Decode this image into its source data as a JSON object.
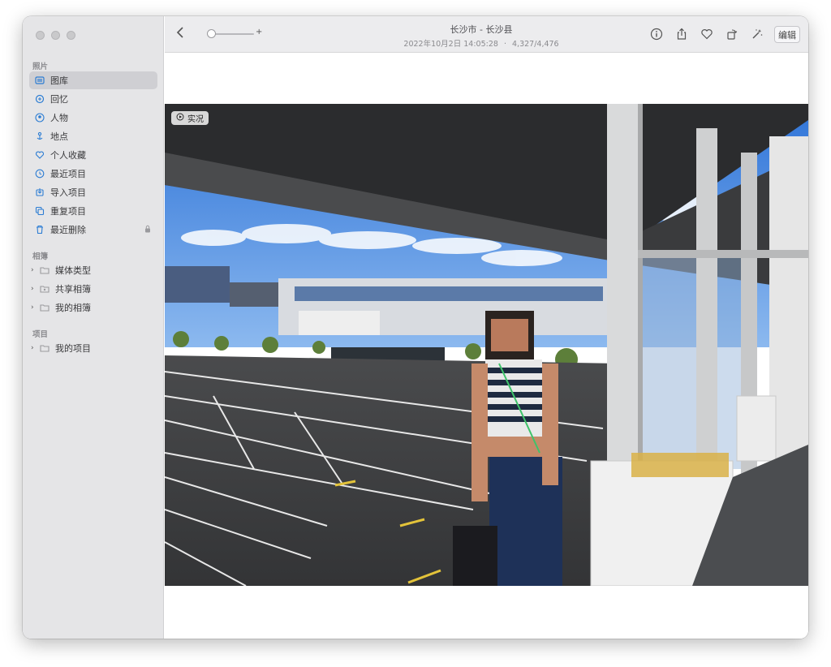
{
  "window": {
    "title": "长沙市 - 长沙县",
    "subtitle_date": "2022年10月2日 14:05:28",
    "subtitle_sep": "·",
    "subtitle_count": "4,327/4,476"
  },
  "toolbar": {
    "zoom_plus": "+",
    "edit_label": "编辑"
  },
  "sidebar": {
    "sections": [
      {
        "title": "照片",
        "items": [
          {
            "label": "图库",
            "icon": "library-icon",
            "selected": true
          },
          {
            "label": "回忆",
            "icon": "memories-icon"
          },
          {
            "label": "人物",
            "icon": "people-icon"
          },
          {
            "label": "地点",
            "icon": "places-icon"
          },
          {
            "label": "个人收藏",
            "icon": "heart-icon"
          },
          {
            "label": "最近项目",
            "icon": "clock-icon"
          },
          {
            "label": "导入项目",
            "icon": "import-icon"
          },
          {
            "label": "重复项目",
            "icon": "duplicates-icon"
          },
          {
            "label": "最近删除",
            "icon": "trash-icon",
            "locked": true
          }
        ]
      },
      {
        "title": "相簿",
        "items": [
          {
            "label": "媒体类型",
            "icon": "folder-icon"
          },
          {
            "label": "共享相簿",
            "icon": "shared-folder-icon"
          },
          {
            "label": "我的相簿",
            "icon": "folder-icon"
          }
        ]
      },
      {
        "title": "项目",
        "items": [
          {
            "label": "我的项目",
            "icon": "folder-icon"
          }
        ]
      }
    ]
  },
  "photo": {
    "live_label": "实况",
    "sky_color": "#3f86e0",
    "accent": "#2b7cd3"
  }
}
